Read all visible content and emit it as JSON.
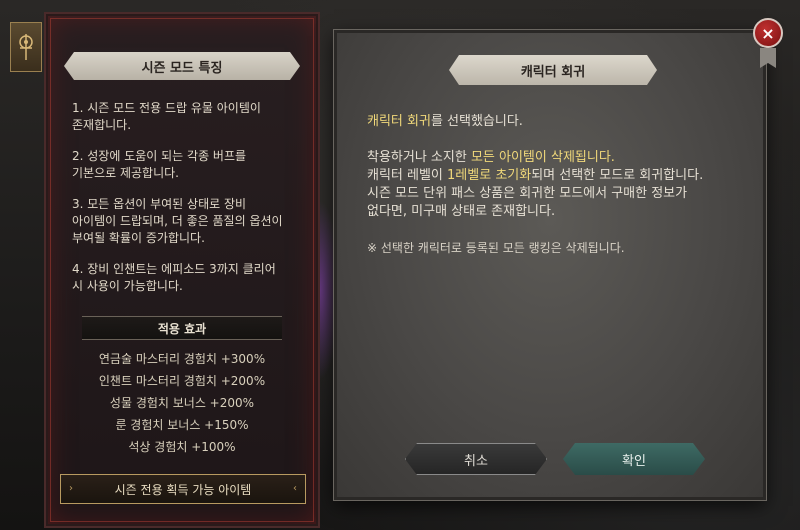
{
  "left_panel": {
    "title": "시즌 모드 특징",
    "items": [
      "1. 시즌 모드 전용 드랍 유물 아이템이\n존재합니다.",
      "2. 성장에 도움이 되는 각종 버프를\n기본으로 제공합니다.",
      "3. 모든 옵션이 부여된 상태로 장비\n아이템이 드랍되며, 더 좋은 품질의 옵션이\n부여될 확률이 증가합니다.",
      "4. 장비 인챈트는 에피소드 3까지 클리어\n시 사용이 가능합니다."
    ],
    "effects_title": "적용 효과",
    "effects": [
      "연금술 마스터리 경험치 +300%",
      "인챈트 마스터리 경험치 +200%",
      "성물 경험치 보너스 +200%",
      "룬 경험치 보너스 +150%",
      "석상 경험치 +100%"
    ],
    "season_items_button": "시즌 전용 획득 가능 아이템"
  },
  "dialog": {
    "title": "캐릭터 회귀",
    "line1_gold": "캐릭터 회귀",
    "line1_rest": "를 선택했습니다.",
    "line2_pre": "착용하거나 소지한 ",
    "line2_gold": "모든 아이템이 삭제됩니다.",
    "line3_pre": "캐릭터 레벨이 ",
    "line3_gold": "1레벨로 초기화",
    "line3_rest": "되며 선택한 모드로 회귀합니다.",
    "line4": "시즌 모드 단위 패스 상품은 회귀한 모드에서 구매한 정보가",
    "line5": "없다면, 미구매 상태로 존재합니다.",
    "note": "※ 선택한 캐릭터로 등록된 모든 랭킹은 삭제됩니다.",
    "cancel_label": "취소",
    "confirm_label": "확인"
  },
  "close_label": "×"
}
